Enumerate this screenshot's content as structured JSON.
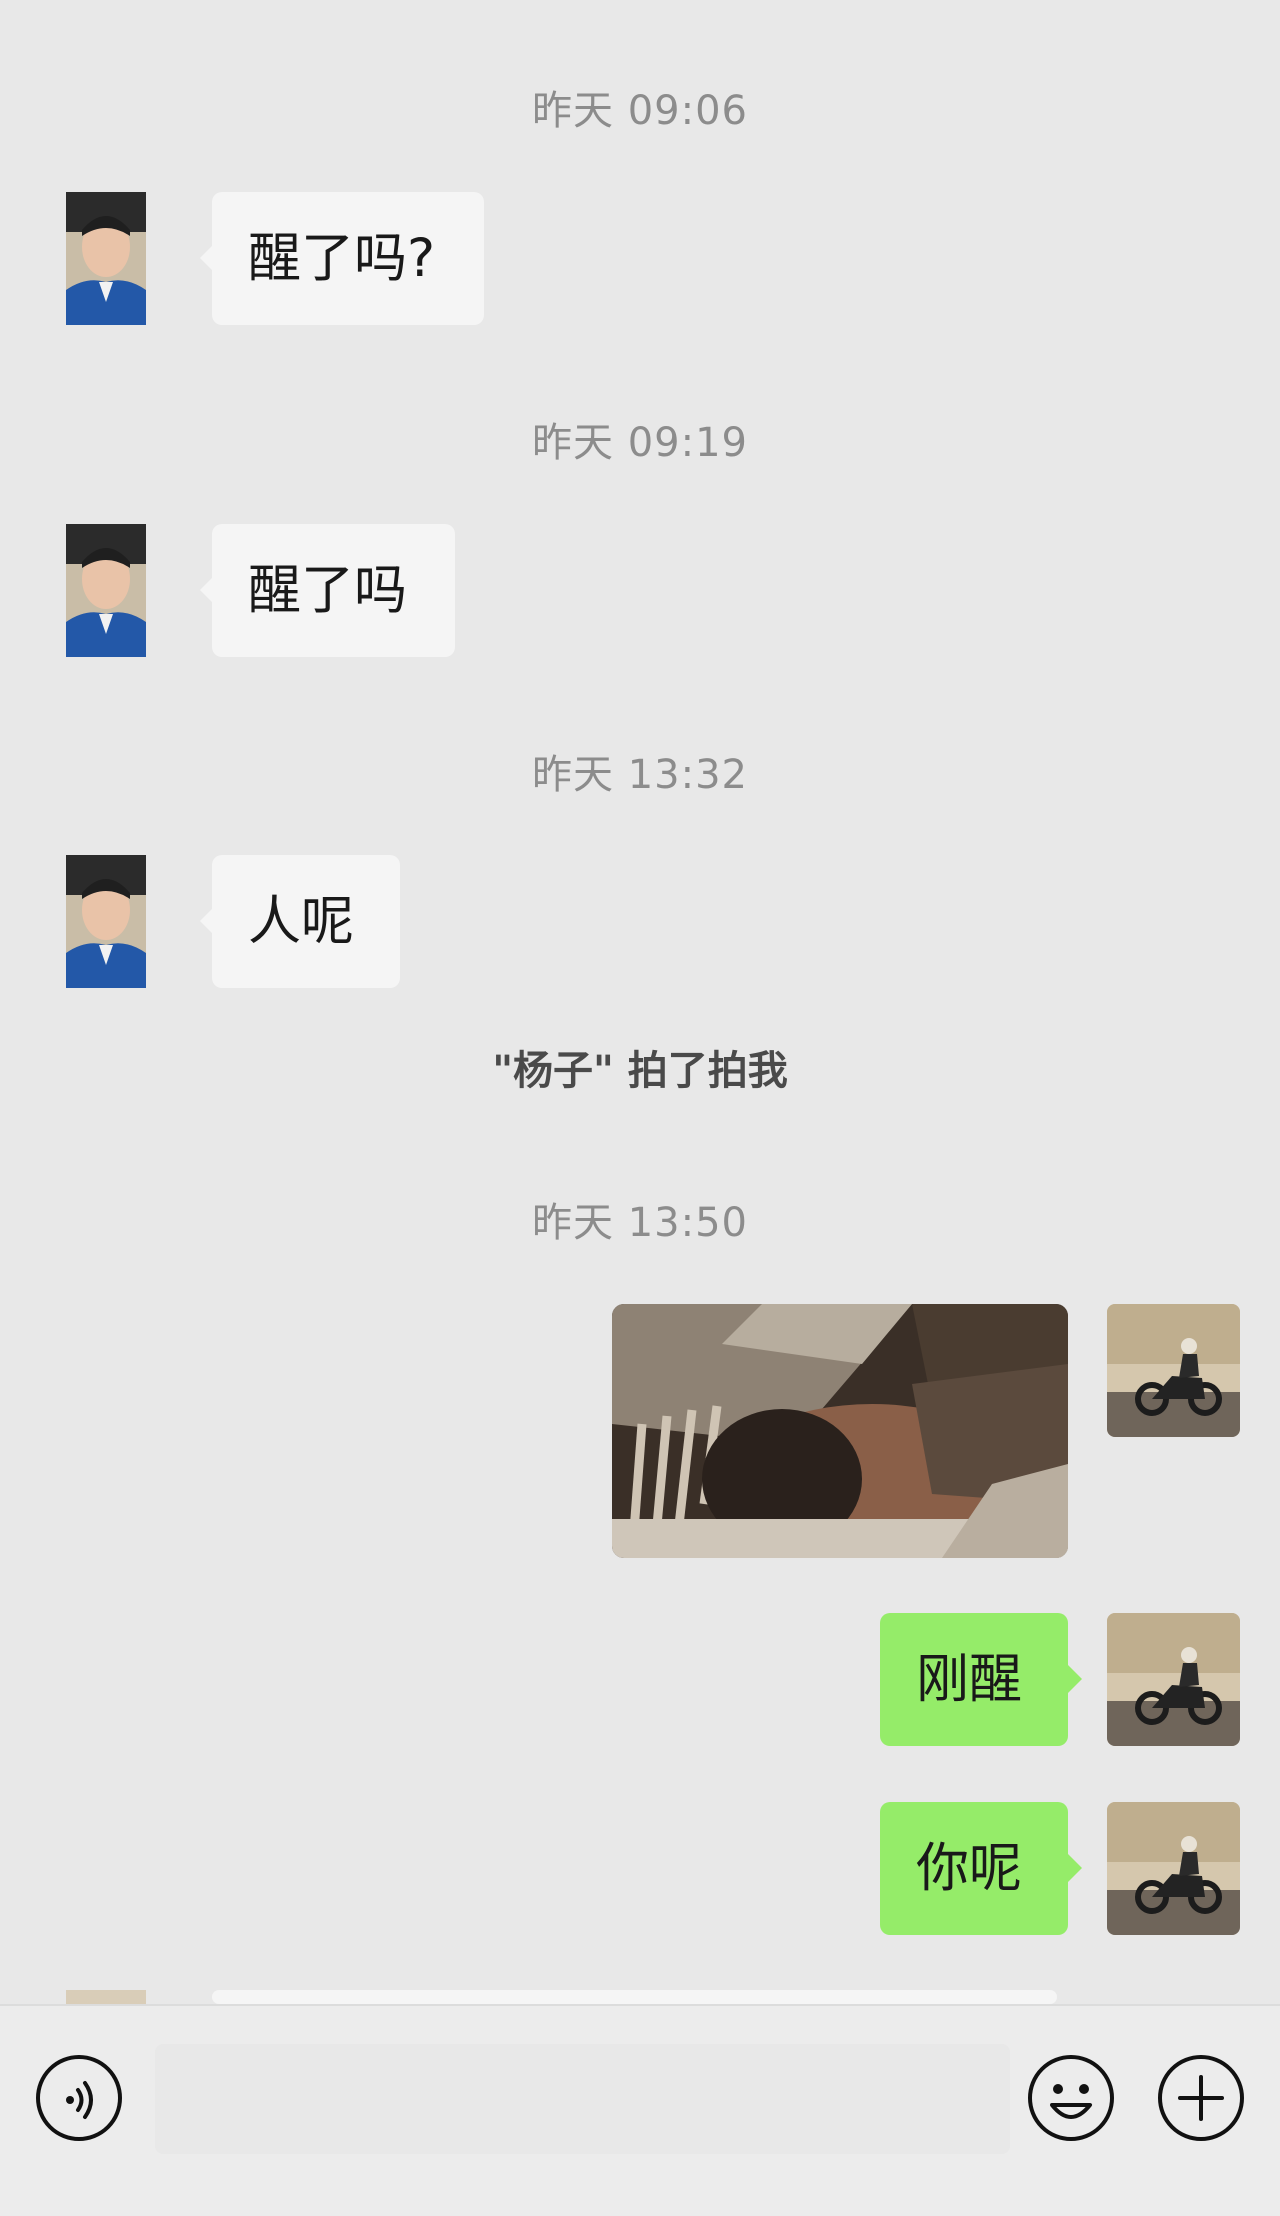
{
  "messages": [
    {
      "type": "timestamp",
      "text": "昨天 09:06"
    },
    {
      "type": "incoming",
      "text": "醒了吗?"
    },
    {
      "type": "timestamp",
      "text": "昨天 09:19"
    },
    {
      "type": "incoming",
      "text": "醒了吗"
    },
    {
      "type": "timestamp",
      "text": "昨天 13:32"
    },
    {
      "type": "incoming",
      "text": "人呢"
    },
    {
      "type": "system",
      "text": "\"杨子\" 拍了拍我"
    },
    {
      "type": "timestamp",
      "text": "昨天 13:50"
    },
    {
      "type": "outgoing-image",
      "description": "photo of a person lying in bed"
    },
    {
      "type": "outgoing",
      "text": "刚醒"
    },
    {
      "type": "outgoing",
      "text": "你呢"
    }
  ],
  "colors": {
    "background": "#e8e8e8",
    "incoming_bubble": "#f5f5f5",
    "outgoing_bubble": "#95ec69",
    "timestamp": "#8c8c8c"
  },
  "input_bar": {
    "icons": [
      "voice-icon",
      "emoji-icon",
      "plus-icon"
    ]
  }
}
